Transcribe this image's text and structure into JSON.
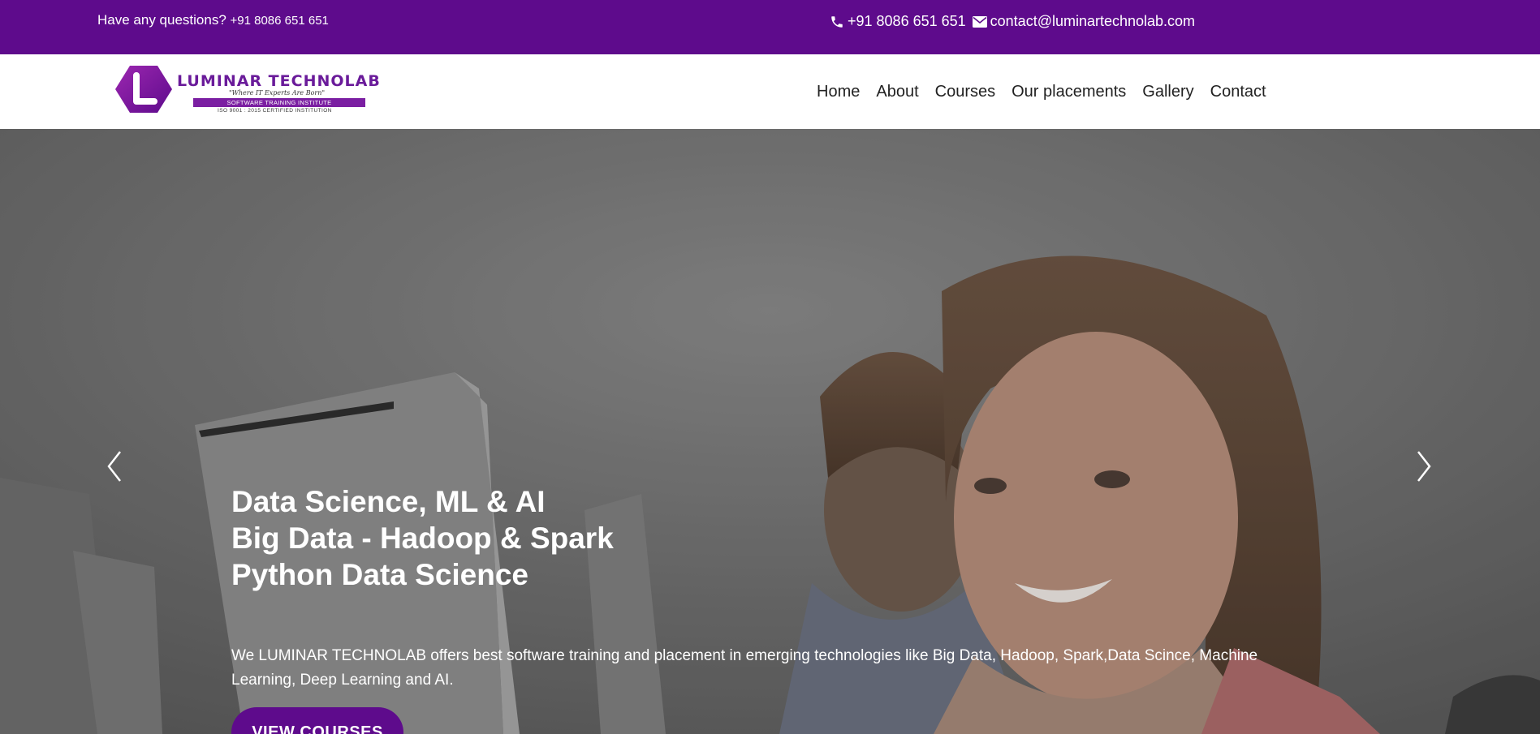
{
  "topbar": {
    "question_label": "Have any questions?",
    "question_phone": "+91 8086 651 651",
    "phone": "+91 8086 651 651",
    "email": "contact@luminartechnolab.com",
    "phone_icon": "phone-icon",
    "email_icon": "envelope-icon",
    "background_color": "#5e0b8c"
  },
  "logo": {
    "brand": "LUMINAR TECHNOLAB",
    "tagline": "\"Where IT Experts Are Born\"",
    "subtitle": "SOFTWARE TRAINING INSTITUTE",
    "certification": "ISO 9001 : 2015 CERTIFIED INSTITUTION"
  },
  "nav": {
    "items": [
      "Home",
      "About",
      "Courses",
      "Our placements",
      "Gallery",
      "Contact"
    ]
  },
  "hero": {
    "headline_lines": [
      "Data Science, ML & AI",
      "Big Data - Hadoop & Spark",
      "Python Data Science"
    ],
    "description": "We LUMINAR TECHNOLAB offers best software training and placement in emerging technologies like Big Data, Hadoop, Spark,Data Scince, Machine Learning, Deep Learning and AI.",
    "cta_label": "VIEW COURSES",
    "prev_icon": "chevron-left-icon",
    "next_icon": "chevron-right-icon"
  }
}
